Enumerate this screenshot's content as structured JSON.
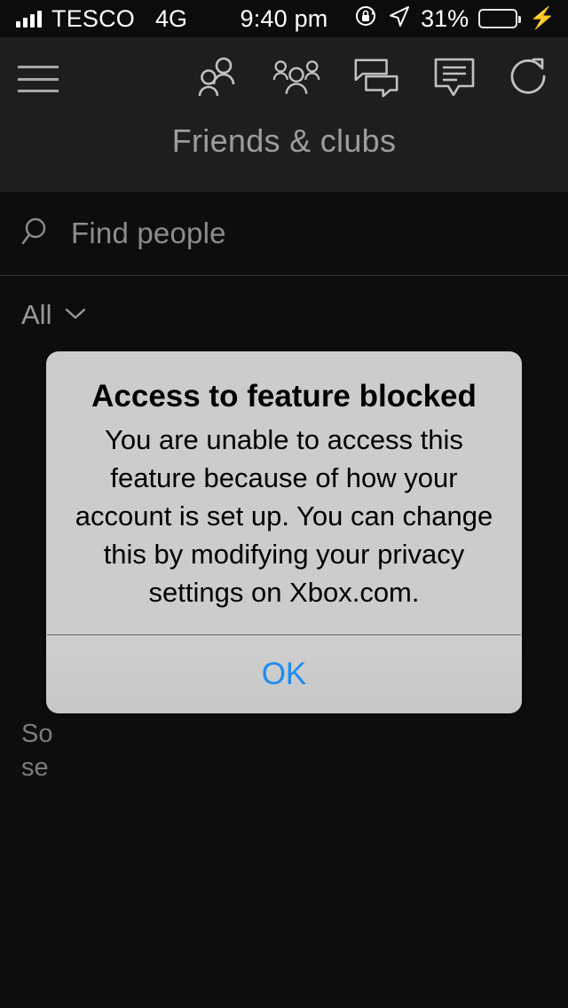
{
  "status_bar": {
    "carrier": "TESCO",
    "network_type": "4G",
    "time": "9:40 pm",
    "battery_percent": "31%",
    "battery_level": 31,
    "icons": {
      "signal": "signal-bars-icon",
      "rotation_lock": "rotation-lock-icon",
      "location": "location-arrow-icon",
      "battery": "battery-icon",
      "charging": "charging-bolt-icon"
    }
  },
  "header": {
    "menu_icon": "hamburger-menu-icon",
    "title": "Friends & clubs",
    "actions": [
      {
        "name": "friends-icon",
        "label": "Friends"
      },
      {
        "name": "clubs-icon",
        "label": "Clubs"
      },
      {
        "name": "party-chat-icon",
        "label": "Party chat"
      },
      {
        "name": "messages-icon",
        "label": "Messages"
      },
      {
        "name": "refresh-icon",
        "label": "Refresh"
      }
    ]
  },
  "search": {
    "placeholder": "Find people",
    "value": "",
    "icon": "search-icon"
  },
  "filter": {
    "label": "All",
    "chevron": "chevron-down-icon"
  },
  "empty_state": {
    "line1": "So",
    "line2": "se"
  },
  "alert": {
    "title": "Access to feature blocked",
    "message": "You are unable to access this feature because of how your account is set up. You can change this by modifying your privacy settings on Xbox.com.",
    "button_label": "OK",
    "button_color": "#1a8cf5",
    "background_color": "#cccccc"
  },
  "colors": {
    "app_background": "#0d0d0d",
    "header_background": "#1e1e1e",
    "status_bar_background": "#0c0c0c",
    "icon_grey": "#a8a8a8",
    "battery_green": "#4cd964"
  }
}
